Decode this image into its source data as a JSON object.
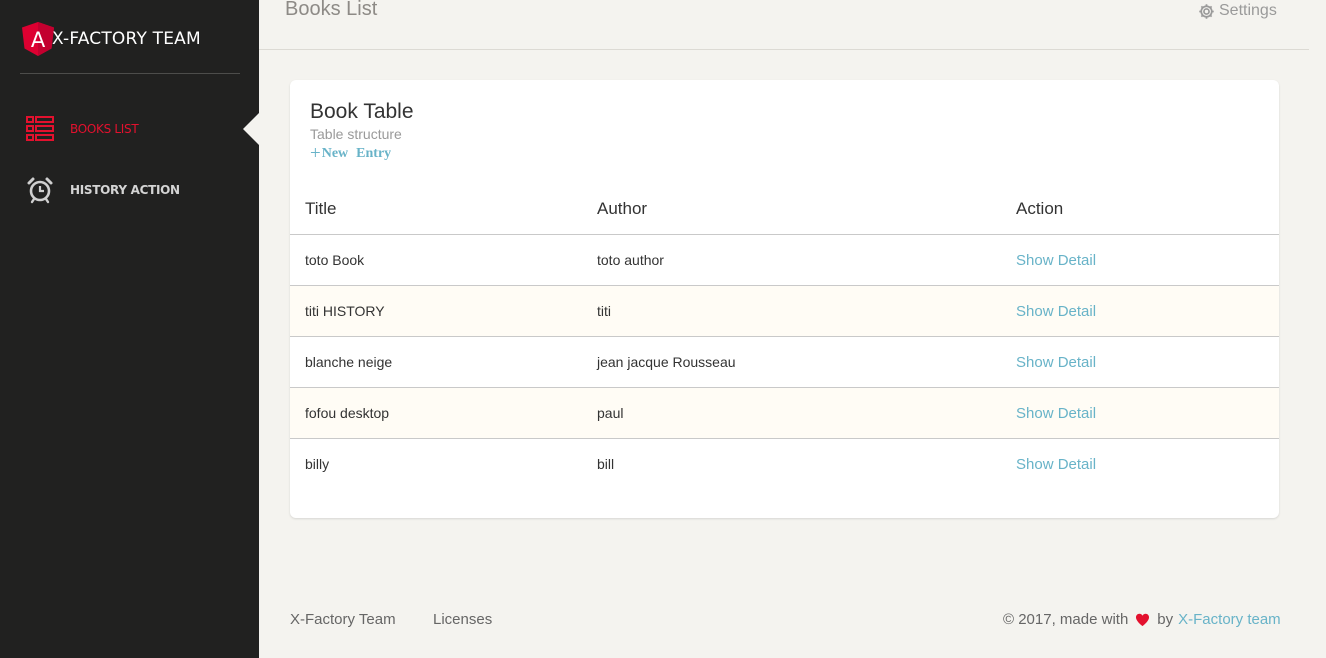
{
  "brand": {
    "letter": "A",
    "name": "X-FACTORY TEAM",
    "accent": "#dd0031"
  },
  "sidebar": {
    "items": [
      {
        "label": "BOOKS LIST",
        "icon": "list-icon",
        "active": true
      },
      {
        "label": "HISTORY ACTION",
        "icon": "alarm-clock-icon",
        "active": false
      }
    ]
  },
  "topbar": {
    "title": "Books List",
    "settings_label": "Settings",
    "settings_icon": "gear-icon"
  },
  "card": {
    "title": "Book Table",
    "subtitle": "Table structure",
    "new_entry": {
      "icon": "plus-icon",
      "word1": "New",
      "word2": "Entry"
    }
  },
  "table": {
    "headers": [
      "Title",
      "Author",
      "Action"
    ],
    "rows": [
      {
        "title": "toto Book",
        "author": "toto author",
        "action": "Show Detail"
      },
      {
        "title": "titi HISTORY",
        "author": "titi",
        "action": "Show Detail"
      },
      {
        "title": "blanche neige",
        "author": "jean jacque Rousseau",
        "action": "Show Detail"
      },
      {
        "title": "fofou desktop",
        "author": "paul",
        "action": "Show Detail"
      },
      {
        "title": "billy",
        "author": "bill",
        "action": "Show Detail"
      }
    ]
  },
  "footer": {
    "links": [
      "X-Factory Team",
      "Licenses"
    ],
    "copyright_prefix": "© 2017, made with",
    "heart_icon": "heart-icon",
    "by_text": "by",
    "team_link": "X-Factory team"
  },
  "colors": {
    "sidebar_bg": "#212120",
    "active_red": "#e3112e",
    "link_blue": "#68b3c8",
    "page_bg": "#f4f3ef",
    "striped_row": "#fffcf5"
  }
}
